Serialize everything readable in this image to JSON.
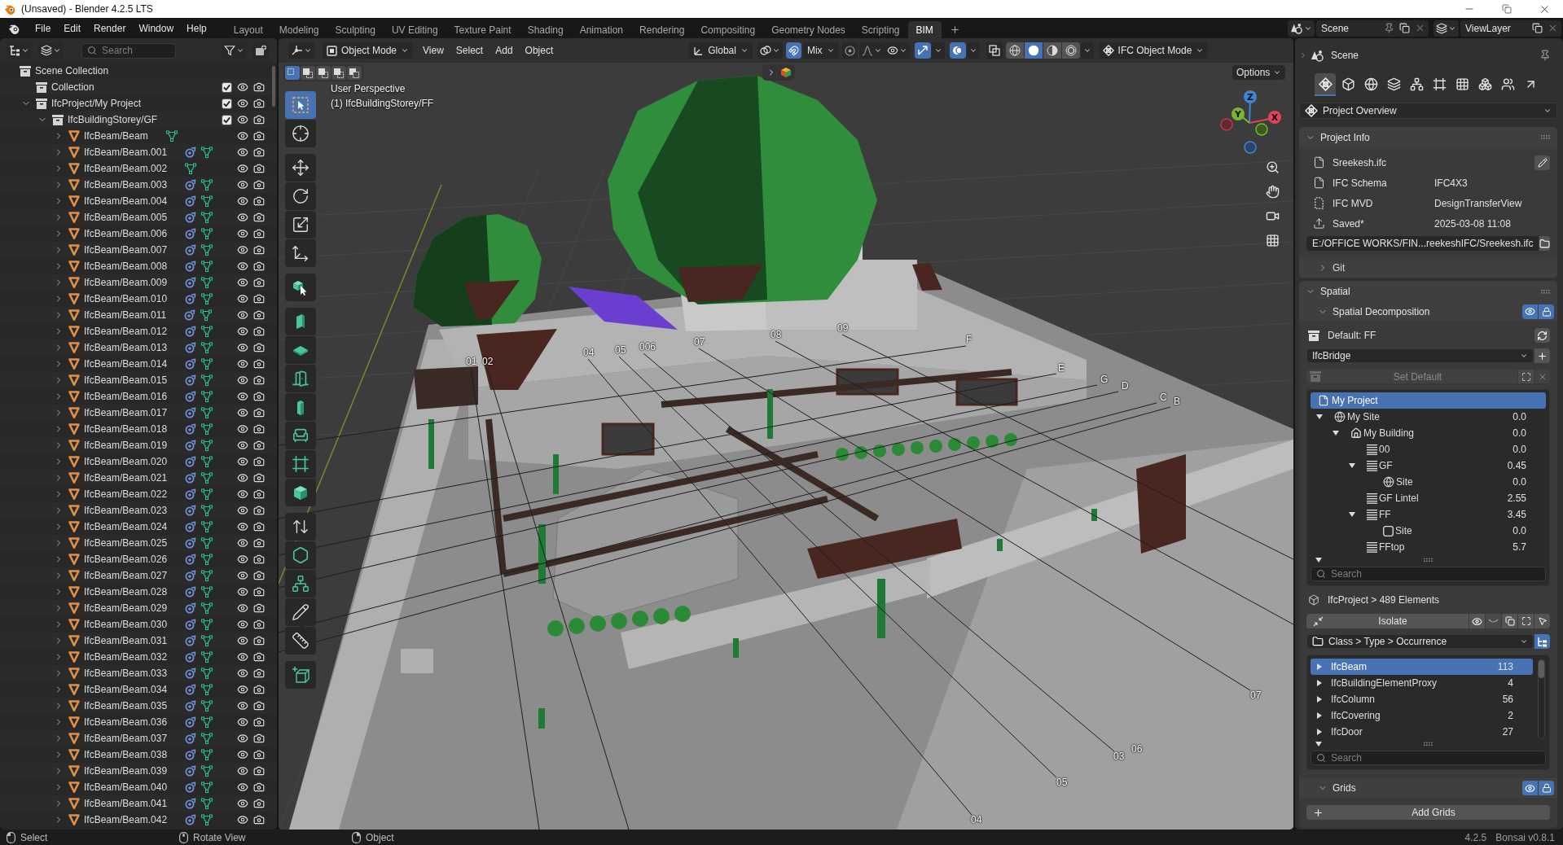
{
  "window": {
    "title": "(Unsaved) - Blender 4.2.5 LTS"
  },
  "menu": [
    "File",
    "Edit",
    "Render",
    "Window",
    "Help"
  ],
  "workspaces": [
    {
      "label": "Layout",
      "selected": false
    },
    {
      "label": "Modeling",
      "selected": false
    },
    {
      "label": "Sculpting",
      "selected": false
    },
    {
      "label": "UV Editing",
      "selected": false
    },
    {
      "label": "Texture Paint",
      "selected": false
    },
    {
      "label": "Shading",
      "selected": false
    },
    {
      "label": "Animation",
      "selected": false
    },
    {
      "label": "Rendering",
      "selected": false
    },
    {
      "label": "Compositing",
      "selected": false
    },
    {
      "label": "Geometry Nodes",
      "selected": false
    },
    {
      "label": "Scripting",
      "selected": false
    },
    {
      "label": "BIM",
      "selected": true
    }
  ],
  "scene_selector": "Scene",
  "view_layer": "ViewLayer",
  "outliner": {
    "search": {
      "placeholder": "Search"
    },
    "tree": [
      {
        "name": "Scene Collection",
        "kind": "scene",
        "children": [
          {
            "name": "Collection",
            "kind": "collection",
            "checked": true
          },
          {
            "name": "IfcProject/My Project",
            "kind": "collection",
            "checked": true,
            "expanded": true,
            "children": [
              {
                "name": "IfcBuildingStorey/GF",
                "kind": "collection",
                "checked": true,
                "expanded": true,
                "children": [
                  {
                    "name": "IfcBeam/Beam",
                    "kind": "mesh",
                    "expanded": false,
                    "modifier": false
                  },
                  {
                    "name": "IfcBeam/Beam.001",
                    "kind": "mesh",
                    "expanded": false,
                    "modifier": true
                  },
                  {
                    "name": "IfcBeam/Beam.002",
                    "kind": "mesh",
                    "expanded": false,
                    "modifier": false
                  },
                  {
                    "name": "IfcBeam/Beam.003",
                    "kind": "mesh",
                    "expanded": false,
                    "modifier": true
                  },
                  {
                    "name": "IfcBeam/Beam.004",
                    "kind": "mesh",
                    "expanded": false,
                    "modifier": true
                  },
                  {
                    "name": "IfcBeam/Beam.005",
                    "kind": "mesh",
                    "expanded": false,
                    "modifier": true
                  },
                  {
                    "name": "IfcBeam/Beam.006",
                    "kind": "mesh",
                    "expanded": false,
                    "modifier": true
                  },
                  {
                    "name": "IfcBeam/Beam.007",
                    "kind": "mesh",
                    "expanded": false,
                    "modifier": true
                  },
                  {
                    "name": "IfcBeam/Beam.008",
                    "kind": "mesh",
                    "expanded": false,
                    "modifier": true
                  },
                  {
                    "name": "IfcBeam/Beam.009",
                    "kind": "mesh",
                    "expanded": false,
                    "modifier": true
                  },
                  {
                    "name": "IfcBeam/Beam.010",
                    "kind": "mesh",
                    "expanded": false,
                    "modifier": true
                  },
                  {
                    "name": "IfcBeam/Beam.011",
                    "kind": "mesh",
                    "expanded": false,
                    "modifier": true
                  },
                  {
                    "name": "IfcBeam/Beam.012",
                    "kind": "mesh",
                    "expanded": false,
                    "modifier": true
                  },
                  {
                    "name": "IfcBeam/Beam.013",
                    "kind": "mesh",
                    "expanded": false,
                    "modifier": true
                  },
                  {
                    "name": "IfcBeam/Beam.014",
                    "kind": "mesh",
                    "expanded": false,
                    "modifier": true
                  },
                  {
                    "name": "IfcBeam/Beam.015",
                    "kind": "mesh",
                    "expanded": false,
                    "modifier": true
                  },
                  {
                    "name": "IfcBeam/Beam.016",
                    "kind": "mesh",
                    "expanded": false,
                    "modifier": true
                  },
                  {
                    "name": "IfcBeam/Beam.017",
                    "kind": "mesh",
                    "expanded": false,
                    "modifier": true
                  },
                  {
                    "name": "IfcBeam/Beam.018",
                    "kind": "mesh",
                    "expanded": false,
                    "modifier": true
                  },
                  {
                    "name": "IfcBeam/Beam.019",
                    "kind": "mesh",
                    "expanded": false,
                    "modifier": true
                  },
                  {
                    "name": "IfcBeam/Beam.020",
                    "kind": "mesh",
                    "expanded": false,
                    "modifier": true
                  },
                  {
                    "name": "IfcBeam/Beam.021",
                    "kind": "mesh",
                    "expanded": false,
                    "modifier": true
                  },
                  {
                    "name": "IfcBeam/Beam.022",
                    "kind": "mesh",
                    "expanded": false,
                    "modifier": true
                  },
                  {
                    "name": "IfcBeam/Beam.023",
                    "kind": "mesh",
                    "expanded": false,
                    "modifier": true
                  },
                  {
                    "name": "IfcBeam/Beam.024",
                    "kind": "mesh",
                    "expanded": false,
                    "modifier": true
                  },
                  {
                    "name": "IfcBeam/Beam.025",
                    "kind": "mesh",
                    "expanded": false,
                    "modifier": true
                  },
                  {
                    "name": "IfcBeam/Beam.026",
                    "kind": "mesh",
                    "expanded": false,
                    "modifier": true
                  },
                  {
                    "name": "IfcBeam/Beam.027",
                    "kind": "mesh",
                    "expanded": false,
                    "modifier": true
                  },
                  {
                    "name": "IfcBeam/Beam.028",
                    "kind": "mesh",
                    "expanded": false,
                    "modifier": true
                  },
                  {
                    "name": "IfcBeam/Beam.029",
                    "kind": "mesh",
                    "expanded": false,
                    "modifier": true
                  },
                  {
                    "name": "IfcBeam/Beam.030",
                    "kind": "mesh",
                    "expanded": false,
                    "modifier": true
                  },
                  {
                    "name": "IfcBeam/Beam.031",
                    "kind": "mesh",
                    "expanded": false,
                    "modifier": true
                  },
                  {
                    "name": "IfcBeam/Beam.032",
                    "kind": "mesh",
                    "expanded": false,
                    "modifier": true
                  },
                  {
                    "name": "IfcBeam/Beam.033",
                    "kind": "mesh",
                    "expanded": false,
                    "modifier": true
                  },
                  {
                    "name": "IfcBeam/Beam.034",
                    "kind": "mesh",
                    "expanded": false,
                    "modifier": true
                  },
                  {
                    "name": "IfcBeam/Beam.035",
                    "kind": "mesh",
                    "expanded": false,
                    "modifier": true
                  },
                  {
                    "name": "IfcBeam/Beam.036",
                    "kind": "mesh",
                    "expanded": false,
                    "modifier": true
                  },
                  {
                    "name": "IfcBeam/Beam.037",
                    "kind": "mesh",
                    "expanded": false,
                    "modifier": true
                  },
                  {
                    "name": "IfcBeam/Beam.038",
                    "kind": "mesh",
                    "expanded": false,
                    "modifier": true
                  },
                  {
                    "name": "IfcBeam/Beam.039",
                    "kind": "mesh",
                    "expanded": false,
                    "modifier": true
                  },
                  {
                    "name": "IfcBeam/Beam.040",
                    "kind": "mesh",
                    "expanded": false,
                    "modifier": true
                  },
                  {
                    "name": "IfcBeam/Beam.041",
                    "kind": "mesh",
                    "expanded": false,
                    "modifier": true
                  },
                  {
                    "name": "IfcBeam/Beam.042",
                    "kind": "mesh",
                    "expanded": false,
                    "modifier": true
                  }
                ]
              }
            ]
          }
        ]
      }
    ]
  },
  "viewport": {
    "editor_mode": "Object Mode",
    "menus": [
      "View",
      "Select",
      "Add",
      "Object"
    ],
    "orientation": "Global",
    "snapping_on": true,
    "snap_target": "Mix",
    "proportional_on": false,
    "gizmos_on": true,
    "overlays_on": true,
    "xray_on": false,
    "shading": [
      {
        "kind": "wireframe",
        "selected": false
      },
      {
        "kind": "solid",
        "selected": true
      },
      {
        "kind": "material",
        "selected": false
      },
      {
        "kind": "rendered",
        "selected": false
      }
    ],
    "ifc_mode": "IFC Object Mode",
    "select_modes": [
      {
        "kind": "set",
        "selected": true
      },
      {
        "kind": "extend",
        "selected": false
      },
      {
        "kind": "subtract",
        "selected": false
      },
      {
        "kind": "invert",
        "selected": false
      },
      {
        "kind": "intersect",
        "selected": false
      }
    ],
    "options": "Options",
    "view_name": "User Perspective",
    "active_object": "(1) IfcBuildingStorey/FF",
    "tool_groups": [
      {
        "tools": [
          {
            "kind": "select_box",
            "selected": true
          },
          {
            "kind": "cursor",
            "selected": false
          }
        ]
      },
      {
        "tools": [
          {
            "kind": "move",
            "selected": false
          },
          {
            "kind": "rotate",
            "selected": false
          },
          {
            "kind": "scale",
            "selected": false
          },
          {
            "kind": "transform",
            "selected": false
          }
        ]
      },
      {
        "tools": [
          {
            "kind": "bim_select",
            "selected": false
          }
        ]
      },
      {
        "tools": [
          {
            "kind": "wall",
            "selected": false
          },
          {
            "kind": "slab",
            "selected": false
          },
          {
            "kind": "door",
            "selected": false
          },
          {
            "kind": "column",
            "selected": false
          },
          {
            "kind": "furniture",
            "selected": false
          },
          {
            "kind": "opening",
            "selected": false
          },
          {
            "kind": "element",
            "selected": false
          }
        ]
      },
      {
        "tools": [
          {
            "kind": "extrude",
            "selected": false
          },
          {
            "kind": "covering",
            "selected": false
          },
          {
            "kind": "mesh",
            "selected": false
          },
          {
            "kind": "annotate",
            "selected": false
          },
          {
            "kind": "measure",
            "selected": false
          }
        ]
      },
      {
        "tools": [
          {
            "kind": "add_cube",
            "selected": false
          }
        ]
      }
    ],
    "gizmo_axes": [
      "Z",
      "Y",
      "X"
    ],
    "grid_labels": [
      "01",
      "02",
      "04",
      "05",
      "006",
      "07",
      "08",
      "09",
      "F",
      "E",
      "G",
      "D",
      "C",
      "B",
      "07",
      "06",
      "03",
      "05",
      "04"
    ]
  },
  "properties": {
    "context": "Scene",
    "tabs": [
      {
        "kind": "project",
        "selected": true
      },
      {
        "kind": "object",
        "selected": false
      },
      {
        "kind": "geometry",
        "selected": false
      },
      {
        "kind": "drawings",
        "selected": false
      },
      {
        "kind": "services",
        "selected": false
      },
      {
        "kind": "structural",
        "selected": false
      },
      {
        "kind": "costing",
        "selected": false
      },
      {
        "kind": "facility",
        "selected": false
      },
      {
        "kind": "people",
        "selected": false
      },
      {
        "kind": "quality",
        "selected": false
      }
    ],
    "overview": "Project Overview",
    "project_info": {
      "title": "Project Info",
      "expanded": true,
      "file": "Sreekesh.ifc",
      "fields": [
        {
          "kind": "schema",
          "label": "IFC Schema",
          "value": "IFC4X3"
        },
        {
          "kind": "mvd",
          "label": "IFC MVD",
          "value": "DesignTransferView"
        },
        {
          "kind": "saved",
          "label": "Saved*",
          "value": "2025-03-08 11:08"
        }
      ],
      "path": "E:/OFFICE WORKS/FIN...reekeshIFC/Sreekesh.ifc",
      "git": {
        "title": "Git",
        "expanded": false
      }
    },
    "spatial": {
      "title": "Spatial",
      "expanded": true,
      "decomposition": {
        "title": "Spatial Decomposition",
        "expanded": true,
        "visible_on": true,
        "locked_on": true
      },
      "default": "Default: FF",
      "class": "IfcBridge",
      "set_default": {
        "label": "Set Default",
        "disabled": true
      },
      "tree": [
        {
          "name": "My Project",
          "kind": "project",
          "selected": true,
          "children": [
            {
              "name": "My Site",
              "kind": "site",
              "elevation": "0.0",
              "expanded": true,
              "selected": false,
              "children": [
                {
                  "name": "My Building",
                  "kind": "building",
                  "elevation": "0.0",
                  "expanded": true,
                  "selected": false,
                  "children": [
                    {
                      "name": "00",
                      "kind": "storey",
                      "elevation": "0.0",
                      "selected": false
                    },
                    {
                      "name": "GF",
                      "kind": "storey",
                      "elevation": "0.45",
                      "expanded": true,
                      "selected": false,
                      "children": [
                        {
                          "name": "Site",
                          "kind": "site",
                          "elevation": "0.0",
                          "selected": false
                        }
                      ]
                    },
                    {
                      "name": "GF Lintel",
                      "kind": "storey",
                      "elevation": "2.55",
                      "selected": false
                    },
                    {
                      "name": "FF",
                      "kind": "storey",
                      "elevation": "3.45",
                      "expanded": true,
                      "selected": false,
                      "children": [
                        {
                          "name": "Site",
                          "kind": "generic",
                          "elevation": "0.0",
                          "selected": false
                        }
                      ]
                    },
                    {
                      "name": "FFtop",
                      "kind": "storey",
                      "elevation": "5.7",
                      "selected": false
                    }
                  ]
                }
              ]
            }
          ]
        }
      ],
      "search": {
        "placeholder": "Search"
      },
      "summary": "IfcProject > 489 Elements",
      "isolate": "Isolate",
      "grouping": "Class > Type > Occurrence",
      "classes": [
        {
          "name": "IfcBeam",
          "count": "113",
          "expanded": false,
          "selected": true
        },
        {
          "name": "IfcBuildingElementProxy",
          "count": "4",
          "expanded": false,
          "selected": false
        },
        {
          "name": "IfcColumn",
          "count": "56",
          "expanded": false,
          "selected": false
        },
        {
          "name": "IfcCovering",
          "count": "2",
          "expanded": false,
          "selected": false
        },
        {
          "name": "IfcDoor",
          "count": "27",
          "expanded": false,
          "selected": false
        }
      ],
      "class_search": {
        "placeholder": "Search"
      },
      "grids": {
        "title": "Grids",
        "expanded": true,
        "visible_on": true,
        "locked_on": true,
        "add": "Add Grids"
      }
    }
  },
  "status_bar": {
    "hints": [
      {
        "kind": "left_click",
        "label": "Select"
      },
      {
        "kind": "middle_click",
        "label": "Rotate View"
      },
      {
        "kind": "right_click",
        "label": "Object"
      }
    ],
    "version": "4.2.5",
    "addon": "Bonsai v0.8.1"
  }
}
